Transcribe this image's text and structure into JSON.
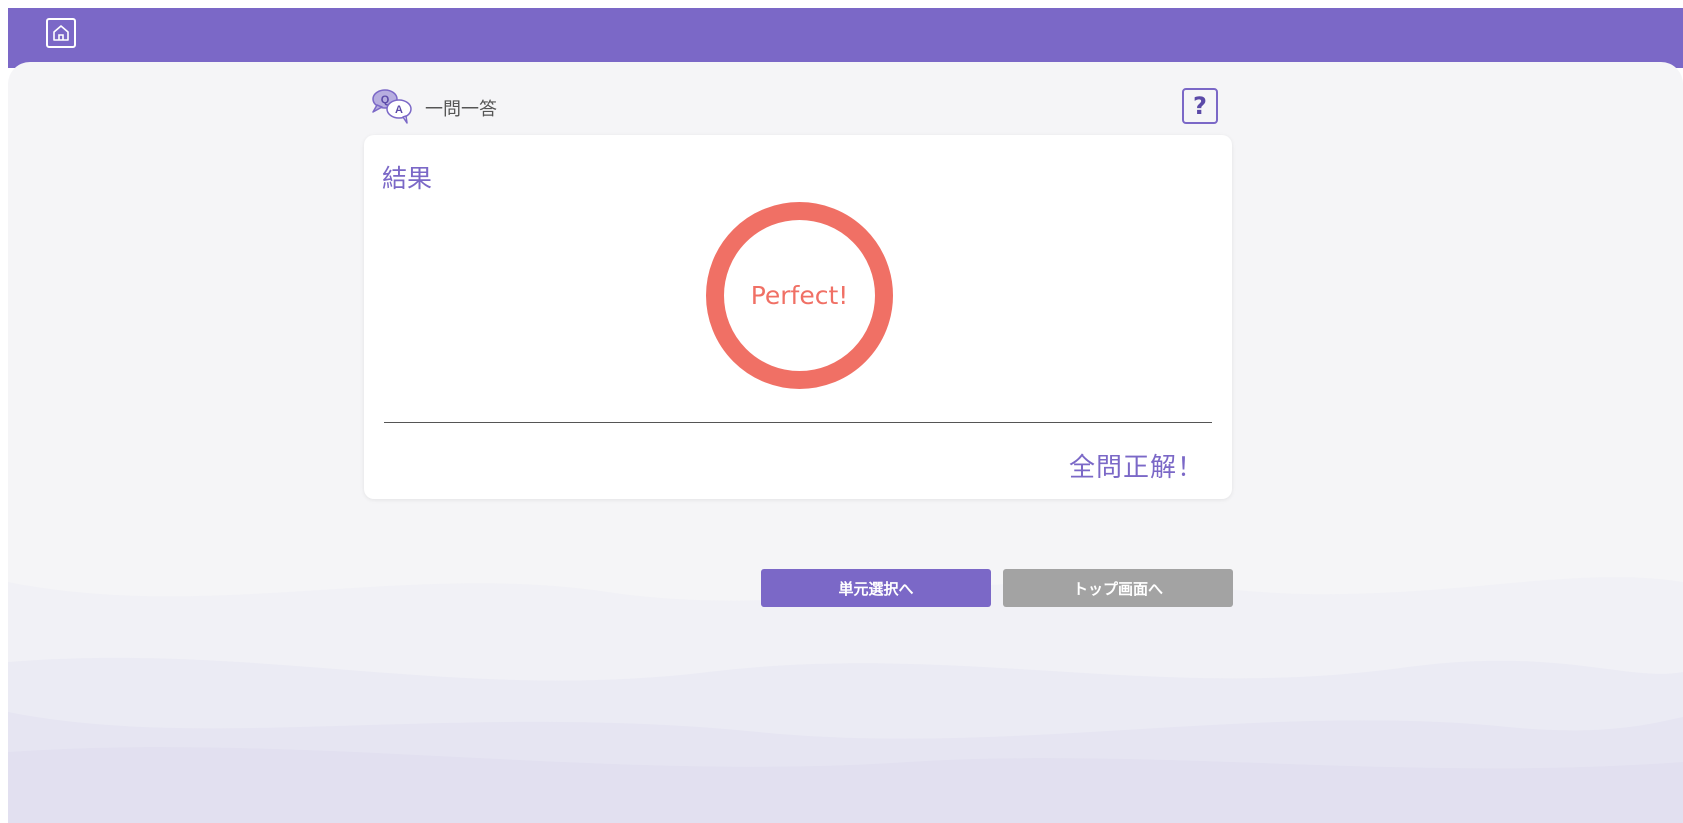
{
  "header": {
    "home_icon": "home-icon",
    "mode_icon": "qa-bubble-icon",
    "mode_icon_q": "Q",
    "mode_icon_a": "A",
    "mode_label": "一問一答",
    "help_label": "?"
  },
  "result": {
    "title": "結果",
    "ring_text": "Perfect!",
    "message": "全問正解！"
  },
  "buttons": {
    "unit_select": "単元選択へ",
    "top_screen": "トップ画面へ"
  },
  "colors": {
    "accent": "#7b68c7",
    "ring": "#f07065",
    "secondary_button": "#a3a3a3",
    "background": "#f5f5f7"
  }
}
